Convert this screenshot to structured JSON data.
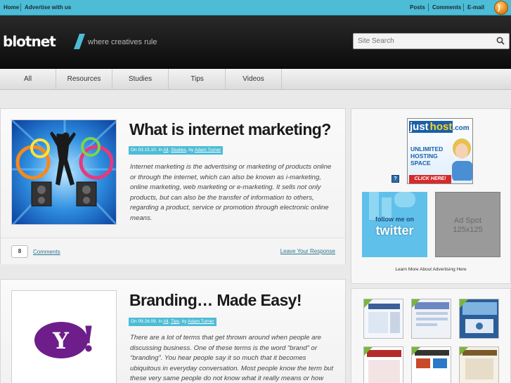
{
  "topbar": {
    "left_links": [
      "Home",
      "Advertise with us"
    ],
    "right_links": [
      "Posts",
      "Comments",
      "E-mail"
    ],
    "rss_icon": "rss-icon"
  },
  "header": {
    "logo": "blotnet",
    "tagline": "where creatives rule",
    "search_placeholder": "Site Search"
  },
  "nav": {
    "items": [
      "All",
      "Resources",
      "Studies",
      "Tips",
      "Videos"
    ]
  },
  "posts": [
    {
      "title": "What is internet marketing?",
      "meta_prefix": "On 03.15.10. In",
      "meta_category": "All",
      "meta_sep": ",",
      "meta_category2": "Studies",
      "meta_by": ", by",
      "meta_author": "Adam Turner",
      "excerpt": "Internet marketing is the advertising or marketing of products online or through the internet, which can also be known as i-marketing, online marketing, web marketing or e-marketing. It sells not only products, but can also be the transfer of information to others, regarding a product, service or promotion through electronic online means.",
      "comment_count": "8",
      "comments_label": "Comments",
      "leave_label": "Leave Your Response"
    },
    {
      "title": "Branding… Made Easy!",
      "meta_prefix": "On 09.26.09. In",
      "meta_category": "All",
      "meta_sep": ",",
      "meta_category2": "Tips",
      "meta_by": ", by",
      "meta_author": "Adam Turner",
      "excerpt": "There are a lot of terms that get thrown around when people are discussing business. One of these terms is the word “brand” or “branding”. You hear people say it so much that it becomes ubiquitous in everyday conversation. Most people know the term but these very same people do not know what it really means or how"
    }
  ],
  "sidebar": {
    "ad_banner": {
      "brand_a": "just",
      "brand_b": "host",
      "brand_c": ".com",
      "line1": "UNLIMITED",
      "line2": "HOSTING",
      "line3": "SPACE",
      "cta": "CLICK HERE!"
    },
    "ad_info": "?",
    "twitter": {
      "line1": "follow me on",
      "line2": "twitter"
    },
    "ad_spot": {
      "line1": "Ad Spot",
      "line2": "125x125"
    },
    "learn_more": "Learn More About Advertising Here"
  },
  "colors": {
    "accent": "#4dbcd6",
    "header": "#111111"
  }
}
